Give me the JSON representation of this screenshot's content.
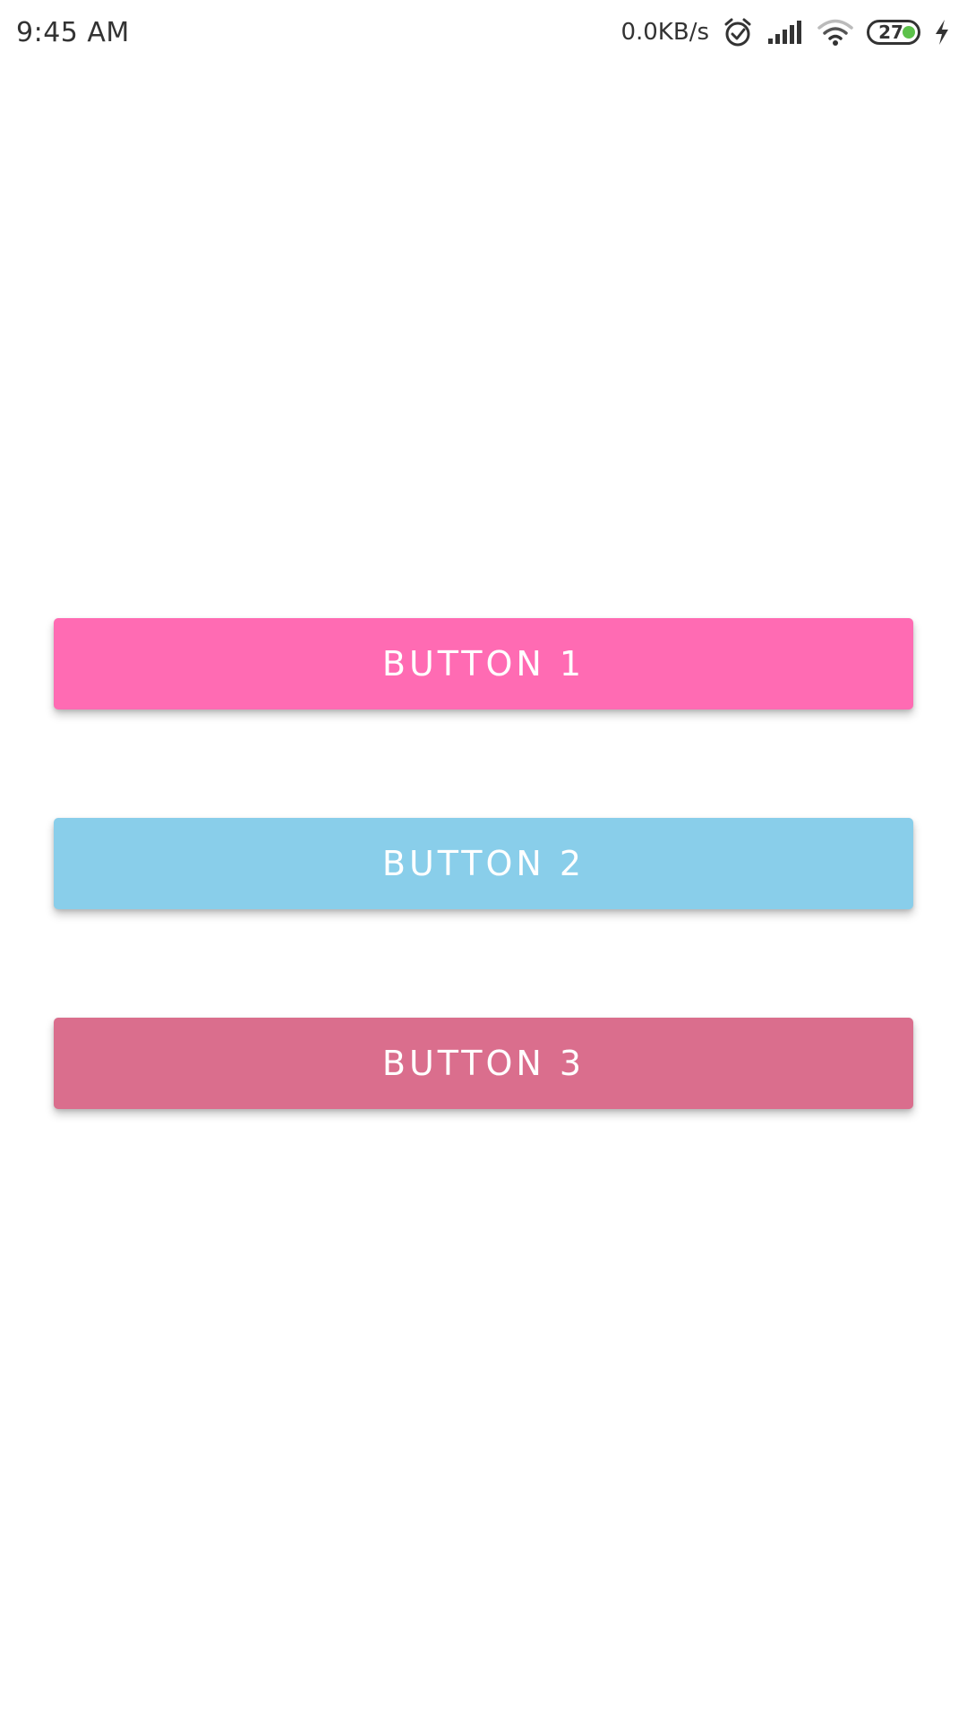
{
  "status_bar": {
    "time": "9:45 AM",
    "net_speed": "0.0KB/s",
    "battery_level": "27",
    "icons": [
      "alarm-clock-icon",
      "signal-icon",
      "wifi-icon",
      "battery-icon",
      "charging-icon"
    ]
  },
  "buttons": [
    {
      "label": "BUTTON 1",
      "color": "#FF6BB3"
    },
    {
      "label": "BUTTON 2",
      "color": "#89CEEA"
    },
    {
      "label": "BUTTON 3",
      "color": "#DA6E8D"
    }
  ]
}
